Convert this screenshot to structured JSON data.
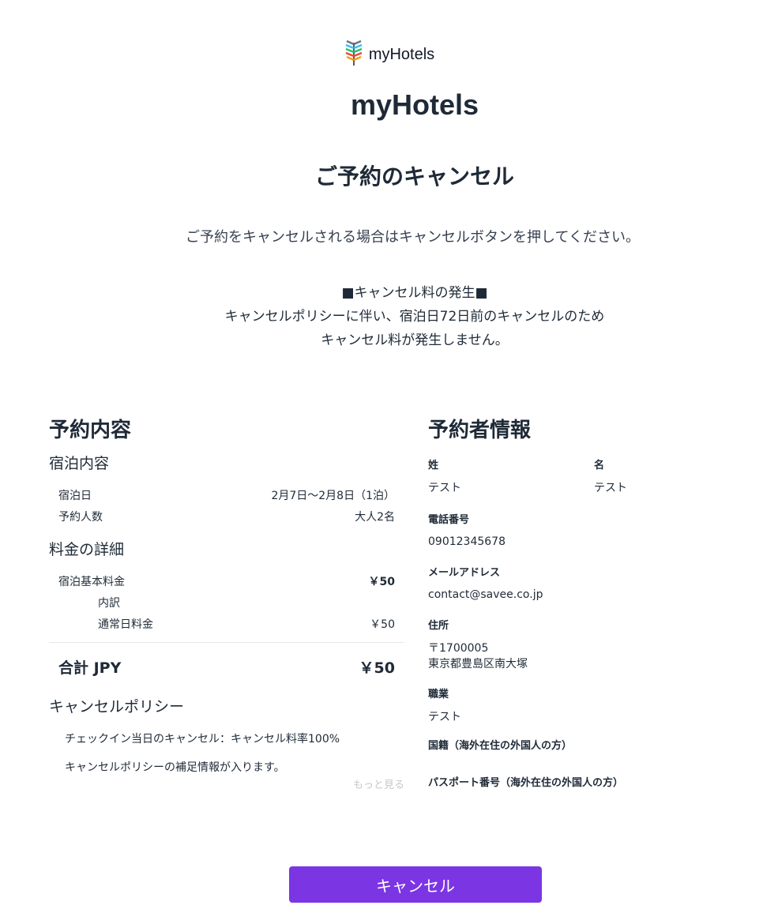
{
  "header": {
    "logo_text": "myHotels",
    "site_title": "myHotels",
    "page_title": "ご予約のキャンセル",
    "instruction": "ご予約をキャンセルされる場合はキャンセルボタンを押してください。"
  },
  "fee_notice": {
    "heading": "■キャンセル料の発生■",
    "line1": "キャンセルポリシーに伴い、宿泊日72日前のキャンセルのため",
    "line2": "キャンセル料が発生しません。"
  },
  "reservation": {
    "section_title": "予約内容",
    "stay_title": "宿泊内容",
    "stay_date_label": "宿泊日",
    "stay_date_value": "2月7日～2月8日（1泊）",
    "guests_label": "予約人数",
    "guests_value": "大人2名",
    "price_title": "料金の詳細",
    "base_label": "宿泊基本料金",
    "base_value": "￥50",
    "breakdown_label": "内訳",
    "normal_label": "通常日料金",
    "normal_value": "￥50",
    "total_label": "合計 JPY",
    "total_value": "￥50",
    "policy_title": "キャンセルポリシー",
    "policy_line1": "チェックイン当日のキャンセル：キャンセル料率100%",
    "policy_line2": "キャンセルポリシーの補足情報が入ります。",
    "more_link": "もっと見る"
  },
  "booker": {
    "section_title": "予約者情報",
    "last_name_label": "姓",
    "last_name_value": "テスト",
    "first_name_label": "名",
    "first_name_value": "テスト",
    "phone_label": "電話番号",
    "phone_value": "09012345678",
    "email_label": "メールアドレス",
    "email_value": "contact@savee.co.jp",
    "address_label": "住所",
    "postal_value": "〒1700005",
    "address_value": "東京都豊島区南大塚",
    "occupation_label": "職業",
    "occupation_value": "テスト",
    "nationality_label": "国籍（海外在住の外国人の方）",
    "passport_label": "パスポート番号（海外在住の外国人の方）"
  },
  "actions": {
    "cancel_label": "キャンセル"
  },
  "colors": {
    "button_bg": "#7c35e3",
    "text": "#1f2a37",
    "muted_link": "#c4c8ce"
  },
  "icons": {
    "logo": "feather-leaf-logo-icon"
  }
}
